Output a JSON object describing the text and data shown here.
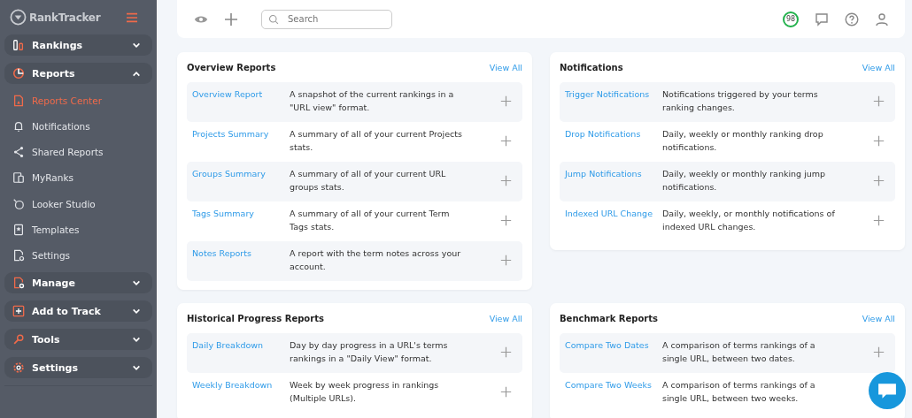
{
  "sidebar": {
    "logo": "RankTracker",
    "items": [
      {
        "label": "Rankings",
        "expanded": false
      },
      {
        "label": "Reports",
        "expanded": true,
        "children": [
          {
            "label": "Reports Center",
            "selected": true
          },
          {
            "label": "Notifications",
            "selected": false
          },
          {
            "label": "Shared Reports",
            "selected": false
          },
          {
            "label": "MyRanks",
            "selected": false
          },
          {
            "label": "Looker Studio",
            "selected": false
          },
          {
            "label": "Templates",
            "selected": false
          },
          {
            "label": "Settings",
            "selected": false
          }
        ]
      },
      {
        "label": "Manage",
        "expanded": false
      },
      {
        "label": "Add to Track",
        "expanded": false
      },
      {
        "label": "Tools",
        "expanded": false
      },
      {
        "label": "Settings",
        "expanded": false
      }
    ]
  },
  "topbar": {
    "search": {
      "placeholder": "Search"
    },
    "score": "98"
  },
  "cards": [
    {
      "title": "Overview Reports",
      "link": "View All",
      "rows": [
        {
          "name": "Overview Report",
          "description": "A snapshot of the current rankings in a \"URL view\" format."
        },
        {
          "name": "Projects Summary",
          "description": "A summary of all of your current Projects stats."
        },
        {
          "name": "Groups Summary",
          "description": "A summary of all of your current URL groups stats."
        },
        {
          "name": "Tags Summary",
          "description": "A summary of all of your current Term Tags stats."
        },
        {
          "name": "Notes Reports",
          "description": "A report with the term notes across your account."
        }
      ]
    },
    {
      "title": "Notifications",
      "link": "View All",
      "rows": [
        {
          "name": "Trigger Notifications",
          "description": "Notifications triggered by your terms ranking changes."
        },
        {
          "name": "Drop Notifications",
          "description": "Daily, weekly or monthly ranking drop notifications."
        },
        {
          "name": "Jump Notifications",
          "description": "Daily, weekly or monthly ranking jump notifications."
        },
        {
          "name": "Indexed URL Change",
          "description": "Daily, weekly, or monthly notifications of indexed URL changes."
        }
      ]
    },
    {
      "title": "Historical Progress Reports",
      "link": "View All",
      "rows": [
        {
          "name": "Daily Breakdown",
          "description": "Day by day progress in a URL's terms rankings in a \"Daily View\" format."
        },
        {
          "name": "Weekly Breakdown",
          "description": "Week by week progress in rankings (Multiple URLs)."
        }
      ]
    },
    {
      "title": "Benchmark Reports",
      "link": "View All",
      "rows": [
        {
          "name": "Compare Two Dates",
          "description": "A comparison of terms rankings of a single URL, between two dates."
        },
        {
          "name": "Compare Two Weeks",
          "description": "A comparison of terms rankings of a single URL, between two weeks."
        }
      ]
    }
  ]
}
